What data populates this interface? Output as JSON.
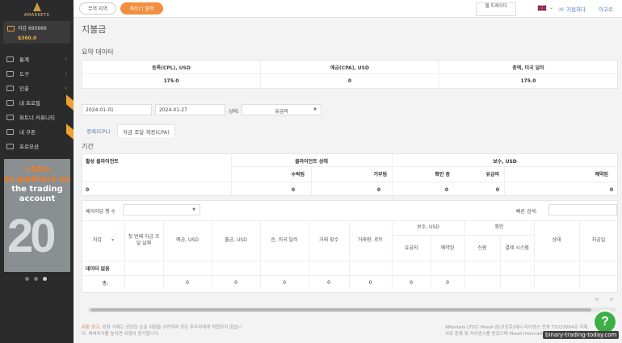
{
  "sidebar": {
    "logo": "AMARKETS",
    "account_name": "지갑 690966",
    "account_balance": "$360.0",
    "menu": [
      {
        "label": "통계"
      },
      {
        "label": "도구"
      },
      {
        "label": "인출"
      },
      {
        "label": "내 프로필"
      },
      {
        "label": "파트너 커뮤니티"
      },
      {
        "label": "내 쿠폰"
      },
      {
        "label": "프로모션"
      }
    ],
    "promo": {
      "line1": "+20%",
      "line2": "to partners on",
      "line3": "the trading",
      "line4": "account",
      "big": "20"
    }
  },
  "topbar": {
    "tab_free": "무역 지역",
    "tab_partner": "파트너 영역",
    "web_trader": "웹 트레이더",
    "contact": "지원하다",
    "logout": "이고르"
  },
  "page": {
    "title": "지불금",
    "summary_title": "요약 데이터",
    "summary": [
      {
        "header": "등록(CPL), USD",
        "value": "175.0"
      },
      {
        "header": "예금(CPA), USD",
        "value": "0"
      },
      {
        "header": "총액, 미국 달러",
        "value": "175.0"
      }
    ],
    "date_from": "2024-01-01",
    "date_to": "2024-01-27",
    "status_label": "상태:",
    "status_value": "유급의",
    "subtabs": [
      "등록(CPL)",
      "자금 조달 계정(CPA)"
    ],
    "period_title": "기간",
    "period_table": {
      "active_clients": "활성 클라이언트",
      "client_status": "클라이언트 상태",
      "reward": "보수, USD",
      "accepted": "수락됨",
      "rejected": "거부됨",
      "checking": "확인 중",
      "paid": "유급의",
      "reserved": "예약된",
      "values": [
        "0",
        "0",
        "0",
        "0",
        "0",
        "0"
      ]
    },
    "rows_per_page": "페이지당 행 수",
    "quick_search": "빠른 검색:",
    "main_table": {
      "headers": [
        "지갑",
        "첫 번째 자금 조달 날짜",
        "예금, USD",
        "출금, USD",
        "순, 미국 달러",
        "거래 횟수",
        "거래량, 로트"
      ],
      "reward_group": "보수, USD",
      "reward_sub": [
        "유급의",
        "예약된"
      ],
      "confirm_group": "확인",
      "confirm_sub": [
        "신원",
        "결제 시스템"
      ],
      "status": "상태",
      "payout": "지급일",
      "no_data": "데이터 없음",
      "total_label": "총:",
      "totals": [
        "0",
        "0",
        "0",
        "0",
        "0",
        "0",
        "0"
      ]
    },
    "pager": {
      "prev": "<",
      "next": ">"
    }
  },
  "footer": {
    "risk_label": "위험 경고:",
    "risk_text_1": "외환 거래는 상당한 손실 위험을 수반하며 모든 투자자에게 적합하지 않습니",
    "risk_text_2": "다. 레버리지를 높이면 위험이 증가합니다.",
    "right_1": "AMarkets LTD는 Mwali 섬(코모로)에서 라이센스 번호 T2023084로 국제",
    "right_2": "사로 등록 및 라이센스를 받았으며 Mwali Internation"
  },
  "watermark": "binary-trading-today.com"
}
